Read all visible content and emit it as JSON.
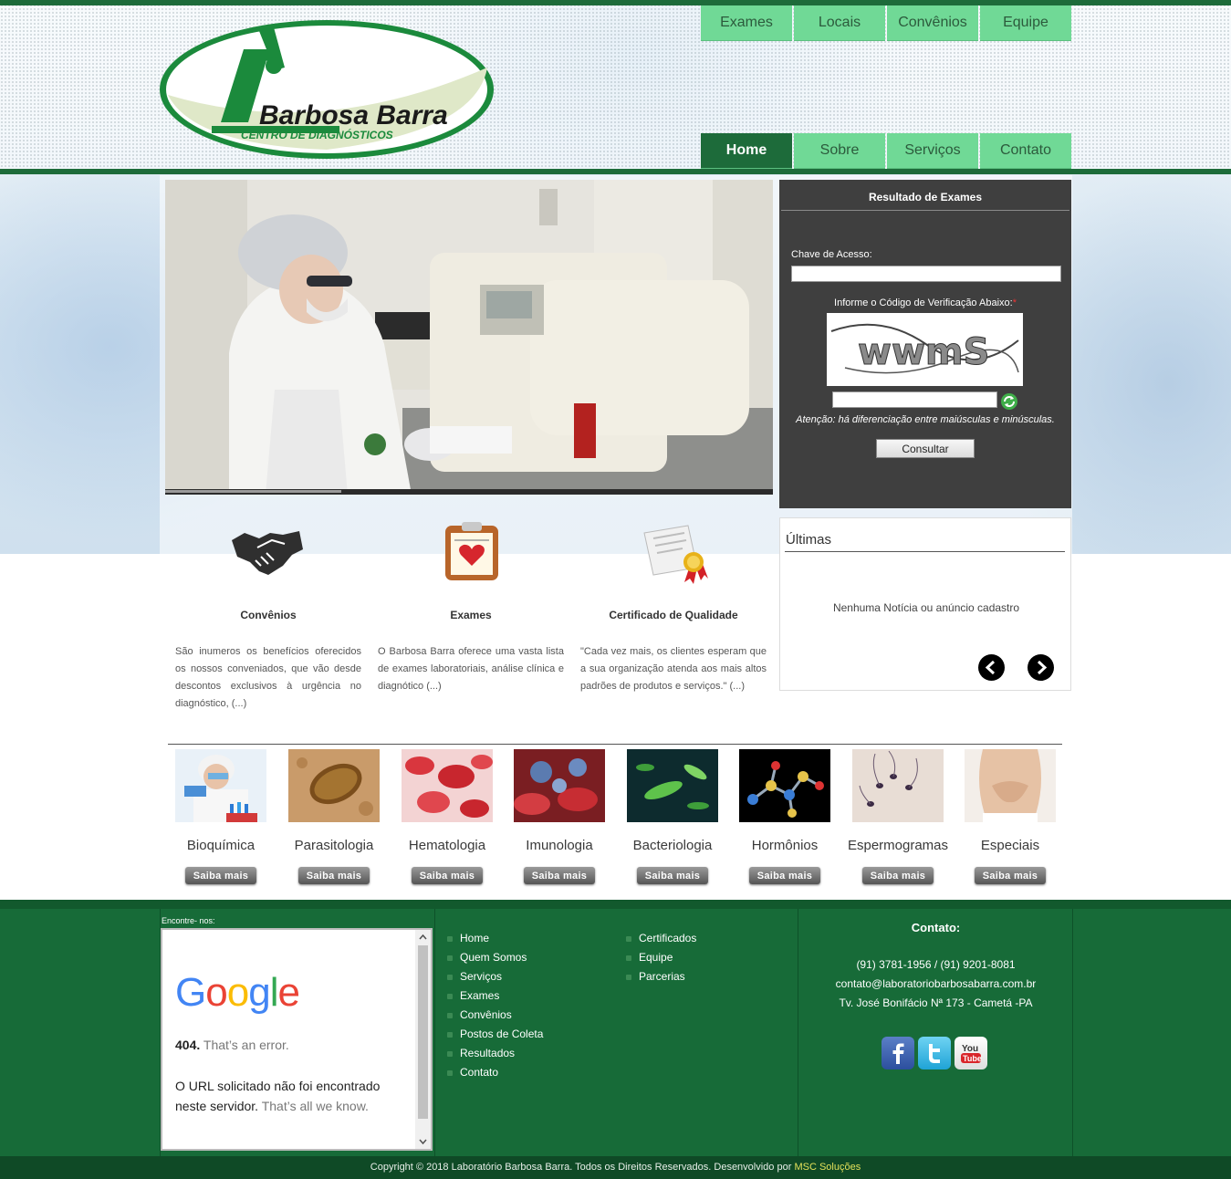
{
  "brand": {
    "name": "Barbosa Barra",
    "tagline": "CENTRO DE DIAGNÓSTICOS"
  },
  "nav_top": [
    "Exames",
    "Locais",
    "Convênios",
    "Equipe"
  ],
  "nav_bottom": [
    "Home",
    "Sobre",
    "Serviços",
    "Contato"
  ],
  "nav_active": "Home",
  "exam_panel": {
    "title": "Resultado de Exames",
    "key_label": "Chave de Acesso:",
    "key_value": "",
    "captcha_label": "Informe o Código de Verificação Abaixo:",
    "captcha_required_mark": "*",
    "captcha_text": "wwmS",
    "captcha_value": "",
    "case_note": "Atenção: há diferenciação entre maiúsculas e minúsculas.",
    "button": "Consultar"
  },
  "slider_progress": 0.29,
  "news": {
    "title": "Últimas",
    "empty_message": "Nenhuma Notícia ou anúncio cadastro"
  },
  "features": [
    {
      "title": "Convênios",
      "desc": "São inumeros os benefícios oferecidos os nossos conveniados, que vão desde descontos exclusivos à urgência no diagnóstico, (...)",
      "icon": "handshake-icon"
    },
    {
      "title": "Exames",
      "desc": "O Barbosa Barra oferece uma vasta lista de exames laboratoriais, análise clínica e diagnótico (...)",
      "icon": "clipboard-heart-icon"
    },
    {
      "title": "Certificado de Qualidade",
      "desc": "\"Cada vez mais, os clientes esperam que a sua organização atenda aos mais altos padrões de produtos e serviços.\" (...)",
      "icon": "certificate-icon"
    }
  ],
  "services": [
    {
      "name": "Bioquímica",
      "button": "Saiba mais"
    },
    {
      "name": "Parasitologia",
      "button": "Saiba mais"
    },
    {
      "name": "Hematologia",
      "button": "Saiba mais"
    },
    {
      "name": "Imunologia",
      "button": "Saiba mais"
    },
    {
      "name": "Bacteriologia",
      "button": "Saiba mais"
    },
    {
      "name": "Hormônios",
      "button": "Saiba mais"
    },
    {
      "name": "Espermogramas",
      "button": "Saiba mais"
    },
    {
      "name": "Especiais",
      "button": "Saiba mais"
    }
  ],
  "footer": {
    "find_us": "Encontre- nos:",
    "map_error": {
      "logo": "Google",
      "code": "404.",
      "code_text": "That’s an error.",
      "message": "O URL solicitado não foi encontrado neste servidor.",
      "message_light": "That’s all we know."
    },
    "links_col1": [
      "Home",
      "Quem Somos",
      "Serviços",
      "Exames",
      "Convênios",
      "Postos de Coleta",
      "Resultados",
      "Contato"
    ],
    "links_col2": [
      "Certificados",
      "Equipe",
      "Parcerias"
    ],
    "contact": {
      "title": "Contato:",
      "phone": "(91) 3781-1956 / (91) 9201-8081",
      "email": "contato@laboratoriobarbosabarra.com.br",
      "address": "Tv. José Bonifácio Nª 173 - Cametá -PA"
    },
    "social": [
      "facebook-icon",
      "twitter-icon",
      "youtube-icon"
    ],
    "youtube_logo_text": [
      "You",
      "Tube"
    ],
    "copyright": "Copyright © 2018 Laboratório Barbosa Barra. Todos os Direitos Reservados. Desenvolvido por",
    "developer": "MSC Soluções"
  },
  "colors": {
    "brand_green": "#1d6b3a",
    "nav_green": "#70d996",
    "footer_green": "#176b38",
    "panel_gray": "#3f3f3f"
  }
}
